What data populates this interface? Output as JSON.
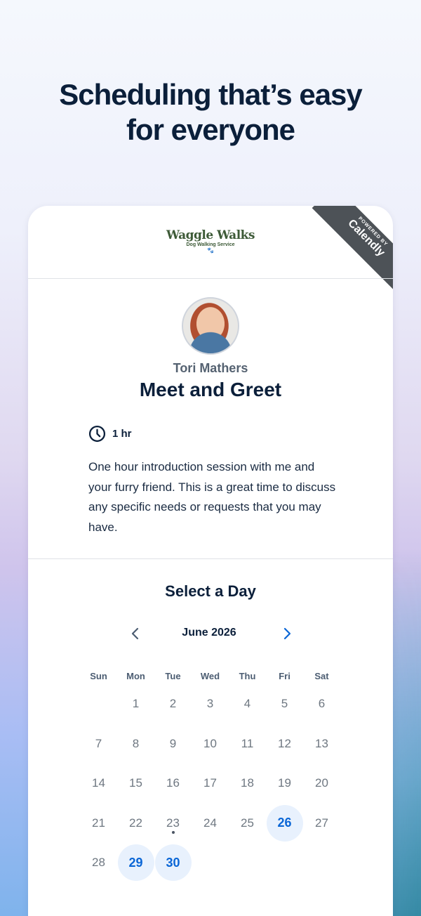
{
  "hero": {
    "line1": "Scheduling that’s easy",
    "line2_prefix": "for ",
    "line2_bold": "everyone"
  },
  "brand": {
    "name": "Waggle Walks",
    "tagline": "Dog Walking Service",
    "paw": "🐾"
  },
  "ribbon": {
    "powered_by": "POWERED BY",
    "name": "Calendly"
  },
  "event": {
    "organizer": "Tori Mathers",
    "title": "Meet and Greet",
    "duration": "1 hr",
    "description": "One hour introduction session with me and your furry friend. This is a great time to discuss any specific needs or requests that you may have."
  },
  "calendar": {
    "heading": "Select a Day",
    "month": "June 2026",
    "weekdays": [
      "Sun",
      "Mon",
      "Tue",
      "Wed",
      "Thu",
      "Fri",
      "Sat"
    ],
    "days": [
      {
        "label": ""
      },
      {
        "label": "1"
      },
      {
        "label": "2"
      },
      {
        "label": "3"
      },
      {
        "label": "4"
      },
      {
        "label": "5"
      },
      {
        "label": "6"
      },
      {
        "label": "7"
      },
      {
        "label": "8"
      },
      {
        "label": "9"
      },
      {
        "label": "10"
      },
      {
        "label": "11"
      },
      {
        "label": "12"
      },
      {
        "label": "13"
      },
      {
        "label": "14"
      },
      {
        "label": "15"
      },
      {
        "label": "16"
      },
      {
        "label": "17"
      },
      {
        "label": "18"
      },
      {
        "label": "19"
      },
      {
        "label": "20"
      },
      {
        "label": "21"
      },
      {
        "label": "22"
      },
      {
        "label": "23",
        "today": true
      },
      {
        "label": "24"
      },
      {
        "label": "25"
      },
      {
        "label": "26",
        "available": true
      },
      {
        "label": "27"
      },
      {
        "label": "28"
      },
      {
        "label": "29",
        "available": true
      },
      {
        "label": "30",
        "available": true
      }
    ]
  },
  "colors": {
    "accent": "#0a66d6",
    "available_bg": "#e8f1fd",
    "ribbon": "#4d5257",
    "brand": "#3d5a37"
  },
  "icons": {
    "clock": "clock-icon",
    "prev": "chevron-left-icon",
    "next": "chevron-right-icon"
  }
}
